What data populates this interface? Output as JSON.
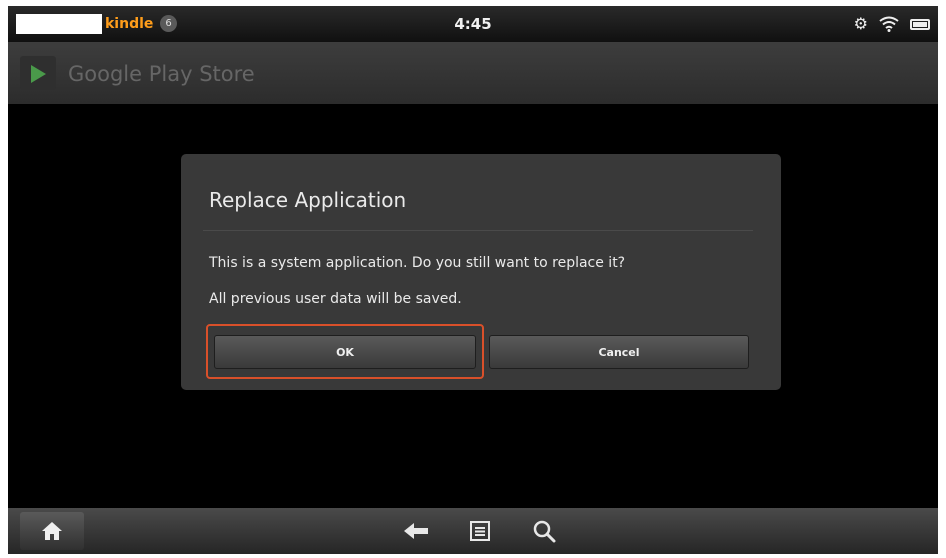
{
  "status_bar": {
    "brand": "kindle",
    "notification_count": "6",
    "time": "4:45",
    "icons": [
      "gear-icon",
      "wifi-icon",
      "battery-icon"
    ]
  },
  "title_bar": {
    "app_name": "Google Play Store",
    "icon": "play-store-icon"
  },
  "dialog": {
    "title": "Replace Application",
    "message_1": "This is a system application. Do you still want to replace it?",
    "message_2": "All previous user data will be saved.",
    "ok_label": "OK",
    "cancel_label": "Cancel",
    "highlight_color": "#d9502a"
  },
  "nav_bar": {
    "icons": [
      "home-icon",
      "back-icon",
      "menu-icon",
      "search-icon"
    ]
  }
}
